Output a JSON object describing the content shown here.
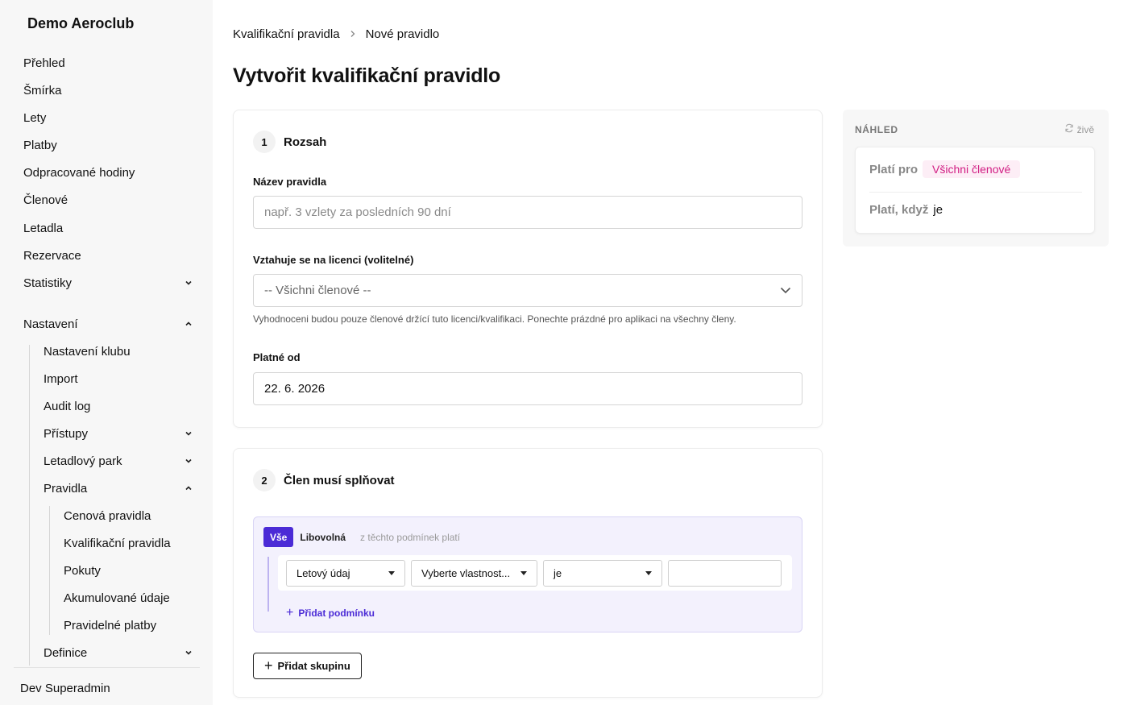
{
  "sidebar": {
    "brand": "Demo Aeroclub",
    "items": [
      "Přehled",
      "Šmírka",
      "Lety",
      "Platby",
      "Odpracované hodiny",
      "Členové",
      "Letadla",
      "Rezervace",
      "Statistiky"
    ],
    "settings": "Nastavení",
    "settings_children": [
      "Nastavení klubu",
      "Import",
      "Audit log",
      "Přístupy",
      "Letadlový park",
      "Pravidla"
    ],
    "rules_children": [
      "Cenová pravidla",
      "Kvalifikační pravidla",
      "Pokuty",
      "Akumulované údaje",
      "Pravidelné platby"
    ],
    "definitions": "Definice",
    "user": "Dev Superadmin"
  },
  "breadcrumb": {
    "parent": "Kvalifikační pravidla",
    "separator": ">",
    "current": "Nové pravidlo"
  },
  "page": {
    "title": "Vytvořit kvalifikační pravidlo"
  },
  "scope": {
    "step_number": "1",
    "step_title": "Rozsah",
    "name_label": "Název pravidla",
    "name_placeholder": "např. 3 vzlety za posledních 90 dní",
    "license_label": "Vztahuje se na licenci (volitelné)",
    "license_value": "-- Všichni členové --",
    "license_hint": "Vyhodnoceni budou pouze členové držící tuto licenci/kvalifikaci. Ponechte prázdné pro aplikaci na všechny členy.",
    "valid_from_label": "Platné od",
    "valid_from_value": "22. 6. 2026"
  },
  "conditions": {
    "step_number": "2",
    "step_title": "Člen musí splňovat",
    "mode_all": "Vše",
    "mode_any": "Libovolná",
    "mode_desc": "z těchto podmínek platí",
    "source_value": "Letový údaj",
    "property_value": "Vyberte vlastnost...",
    "operator_value": "je",
    "add_condition": "Přidat podmínku",
    "add_group": "Přidat skupinu"
  },
  "preview": {
    "title": "NÁHLED",
    "live": "živě",
    "applies_to_label": "Platí pro",
    "applies_to_value": "Všichni členové",
    "applies_when_label": "Platí, když",
    "applies_when_value": "je"
  },
  "colors": {
    "accent": "#4b2bd6",
    "badge_text": "#d11d83",
    "badge_bg": "#fdeef6"
  }
}
